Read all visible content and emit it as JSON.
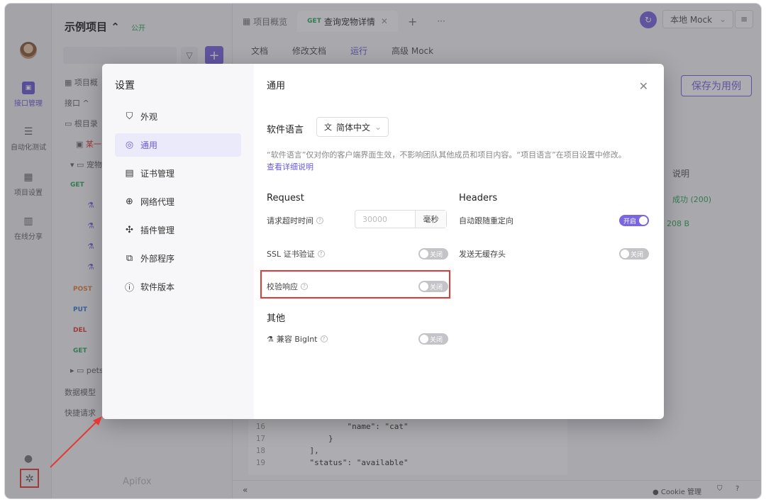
{
  "window": {
    "traffic_colors": [
      "#ff5f57",
      "#febc2e",
      "#28c840"
    ]
  },
  "rail": {
    "items": [
      {
        "label": "接口管理",
        "icon": "api-icon"
      },
      {
        "label": "自动化测试",
        "icon": "automation-icon"
      },
      {
        "label": "项目设置",
        "icon": "project-settings-icon"
      },
      {
        "label": "在线分享",
        "icon": "share-icon"
      }
    ]
  },
  "project": {
    "name": "示例项目 ⌃",
    "visibility": "公开",
    "tree": {
      "overview": "项目概",
      "interfaces": "接口 ^",
      "root": "根目录",
      "item_m": "某一",
      "pet_folder": "宠物",
      "get": "GET",
      "post": "POST",
      "put": "PUT",
      "del": "DEL",
      "get2": "GET",
      "pets": "pets",
      "data_model": "数据模型",
      "quick_request": "快捷请求"
    },
    "brand": "Apifox"
  },
  "main": {
    "tabs": [
      "项目概览",
      "查询宠物详情"
    ],
    "active_tab_method": "GET",
    "subtabs": [
      "文档",
      "修改文档",
      "运行",
      "高级 Mock"
    ],
    "env": "本地 Mock",
    "save_case": "保存为用例",
    "right_col_header": "说明",
    "response_status": "成功 (200)",
    "response_size": "208 B",
    "code_lines": [
      {
        "n": "16",
        "t": "            \"name\": \"cat\""
      },
      {
        "n": "17",
        "t": "        }"
      },
      {
        "n": "18",
        "t": "    ],"
      },
      {
        "n": "19",
        "t": "    \"status\": \"available\""
      }
    ],
    "bottom": {
      "cookie": "Cookie 管理"
    }
  },
  "modal": {
    "side_title": "设置",
    "nav": [
      {
        "label": "外观",
        "icon": "shirt-icon",
        "glyph": "⛉"
      },
      {
        "label": "通用",
        "icon": "general-icon",
        "glyph": "◎",
        "active": true
      },
      {
        "label": "证书管理",
        "icon": "certificate-icon",
        "glyph": "▤"
      },
      {
        "label": "网络代理",
        "icon": "globe-icon",
        "glyph": "⊕"
      },
      {
        "label": "插件管理",
        "icon": "plugin-icon",
        "glyph": "✣"
      },
      {
        "label": "外部程序",
        "icon": "external-icon",
        "glyph": "⧉"
      },
      {
        "label": "软件版本",
        "icon": "info-icon",
        "glyph": "ⓘ"
      }
    ],
    "title": "通用",
    "language": {
      "label": "软件语言",
      "value": "简体中文",
      "note": "“软件语言”仅对你的客户端界面生效，不影响团队其他成员和项目内容。“项目语言”在项目设置中修改。",
      "link": "查看详细说明"
    },
    "request": {
      "title": "Request",
      "timeout_label": "请求超时时间",
      "timeout_placeholder": "30000",
      "timeout_unit": "毫秒",
      "ssl_label": "SSL 证书验证",
      "ssl_state": "关闭",
      "validate_label": "校验响应",
      "validate_state": "关闭"
    },
    "headers": {
      "title": "Headers",
      "redirect_label": "自动跟随重定向",
      "redirect_state": "开启",
      "nocache_label": "发送无缓存头",
      "nocache_state": "关闭"
    },
    "other": {
      "title": "其他",
      "bigint_label": "兼容 BigInt",
      "bigint_state": "关闭"
    }
  }
}
